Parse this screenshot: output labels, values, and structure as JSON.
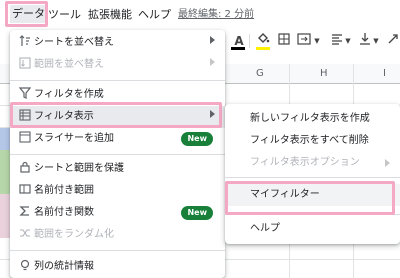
{
  "menubar": {
    "data": "データ",
    "tools": "ツール",
    "extensions": "拡張機能",
    "help": "ヘルプ",
    "last_edit": "最終編集: 2 分前"
  },
  "toolbar": {
    "text_color": "A",
    "fill_icon": "paint-bucket-icon",
    "borders_icon": "borders-icon",
    "merge_icon": "merge-cells-icon",
    "align_icons": [
      "horizontal-align-icon",
      "vertical-align-icon",
      "text-rotation-icon"
    ]
  },
  "sheet": {
    "columns": [
      "G",
      "H",
      "I"
    ]
  },
  "data_menu": {
    "items": [
      {
        "label": "シートを並べ替え",
        "icon": "sort-icon",
        "submenu": true,
        "disabled": false
      },
      {
        "label": "範囲を並べ替え",
        "icon": "sort-range-icon",
        "submenu": true,
        "disabled": true
      },
      {
        "label": "フィルタを作成",
        "icon": "filter-icon",
        "submenu": false,
        "disabled": false
      },
      {
        "label": "フィルタ表示",
        "icon": "filter-view-icon",
        "submenu": true,
        "disabled": false,
        "active": true
      },
      {
        "label": "スライサーを追加",
        "icon": "slicer-icon",
        "submenu": false,
        "disabled": false,
        "badge": "New"
      },
      {
        "label": "シートと範囲を保護",
        "icon": "lock-icon",
        "submenu": false,
        "disabled": false
      },
      {
        "label": "名前付き範囲",
        "icon": "named-range-icon",
        "submenu": false,
        "disabled": false
      },
      {
        "label": "名前付き関数",
        "icon": "sigma-icon",
        "submenu": false,
        "disabled": false,
        "badge": "New"
      },
      {
        "label": "範囲をランダム化",
        "icon": "shuffle-icon",
        "submenu": false,
        "disabled": true
      },
      {
        "label": "列の統計情報",
        "icon": "lightbulb-icon",
        "submenu": false,
        "disabled": false
      }
    ]
  },
  "filter_view_submenu": {
    "items": [
      {
        "label": "新しいフィルタ表示を作成",
        "disabled": false
      },
      {
        "label": "フィルタ表示をすべて削除",
        "disabled": false
      },
      {
        "label": "フィルタ表示オプション",
        "disabled": true,
        "submenu": true
      },
      {
        "label": "マイフィルター",
        "disabled": false,
        "active": true
      },
      {
        "label": "ヘルプ",
        "disabled": false
      }
    ]
  },
  "colors": {
    "highlight": "#f4a8c4",
    "new_badge": "#188038",
    "active_row": "#e8eaed",
    "left_strip_blue": "#b4c7e7",
    "left_strip_green": "#b6d7a8",
    "left_strip_pink": "#ead1dc"
  }
}
